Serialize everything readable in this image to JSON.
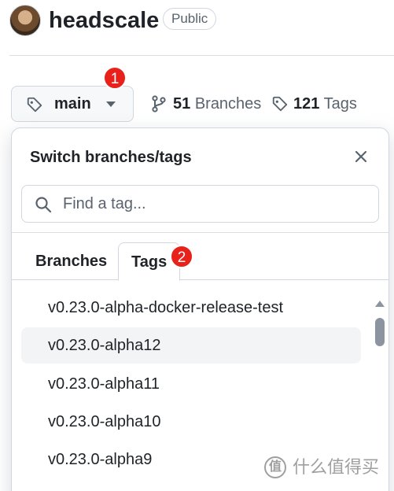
{
  "repo": {
    "name": "headscale",
    "visibility": "Public"
  },
  "branch_selector": {
    "current": "main",
    "icon": "tag-icon"
  },
  "counts": {
    "branches_num": "51",
    "branches_label": "Branches",
    "tags_num": "121",
    "tags_label": "Tags"
  },
  "annotations": {
    "badge1": "1",
    "badge2": "2",
    "color": "#e8221b"
  },
  "panel": {
    "title": "Switch branches/tags",
    "search_placeholder": "Find a tag...",
    "tabs": [
      {
        "label": "Branches",
        "selected": false
      },
      {
        "label": "Tags",
        "selected": true
      }
    ],
    "items": [
      {
        "label": "v0.23.0-alpha-docker-release-test",
        "highlighted": false
      },
      {
        "label": "v0.23.0-alpha12",
        "highlighted": true
      },
      {
        "label": "v0.23.0-alpha11",
        "highlighted": false
      },
      {
        "label": "v0.23.0-alpha10",
        "highlighted": false
      },
      {
        "label": "v0.23.0-alpha9",
        "highlighted": false
      }
    ]
  },
  "watermark": {
    "badge": "值",
    "text": "什么值得买"
  },
  "colors": {
    "text": "#1f2328",
    "muted": "#59636e",
    "border": "#d0d7de",
    "highlight": "#f3f4f6"
  }
}
